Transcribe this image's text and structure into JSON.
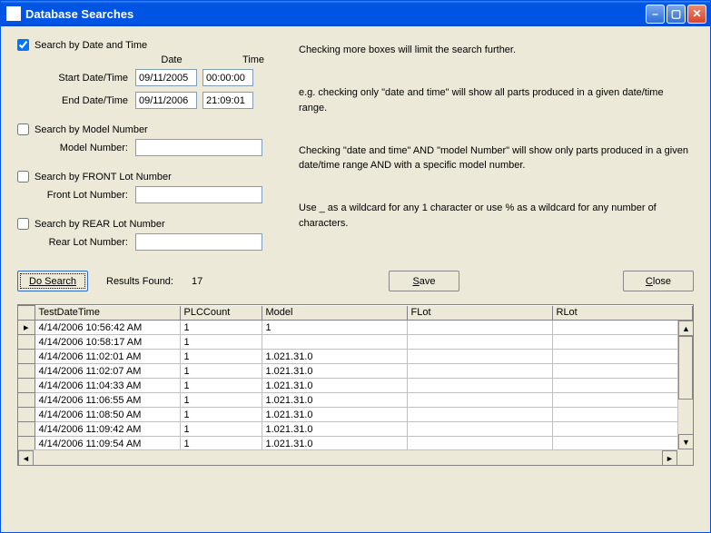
{
  "title": "Database Searches",
  "checks": {
    "dateTime": {
      "label": "Search by Date and Time",
      "checked": true
    },
    "model": {
      "label": "Search by Model Number",
      "checked": false
    },
    "frontLot": {
      "label": "Search by FRONT Lot Number",
      "checked": false
    },
    "rearLot": {
      "label": "Search by REAR Lot Number",
      "checked": false
    }
  },
  "headers": {
    "date": "Date",
    "time": "Time"
  },
  "fields": {
    "startLabel": "Start Date/Time",
    "startDate": "09/11/2005",
    "startTime": "00:00:00",
    "endLabel": "End Date/Time",
    "endDate": "09/11/2006",
    "endTime": "21:09:01",
    "modelLabel": "Model Number:",
    "modelValue": "",
    "frontLabel": "Front Lot Number:",
    "frontValue": "",
    "rearLabel": "Rear Lot Number:",
    "rearValue": ""
  },
  "buttons": {
    "doSearch": "Do Search",
    "save": "Save",
    "close": "Close"
  },
  "resultsLabel": "Results Found:",
  "resultsCount": "17",
  "help": {
    "p1": "Checking more boxes will limit the search further.",
    "p2": "e.g. checking only \"date and time\" will show all parts produced in a given date/time range.",
    "p3": "Checking \"date and time\" AND \"model Number\" will show only parts produced in a given date/time range AND with a specific model number.",
    "p4": "Use _ as a wildcard for any 1 character or use % as a wildcard for any number of characters."
  },
  "grid": {
    "columns": [
      "TestDateTime",
      "PLCCount",
      "Model",
      "FLot",
      "RLot"
    ],
    "rows": [
      {
        "TestDateTime": "4/14/2006 10:56:42 AM",
        "PLCCount": "1",
        "Model": "1",
        "FLot": "",
        "RLot": ""
      },
      {
        "TestDateTime": "4/14/2006 10:58:17 AM",
        "PLCCount": "1",
        "Model": "",
        "FLot": "",
        "RLot": ""
      },
      {
        "TestDateTime": "4/14/2006 11:02:01 AM",
        "PLCCount": "1",
        "Model": "1.021.31.0",
        "FLot": "",
        "RLot": ""
      },
      {
        "TestDateTime": "4/14/2006 11:02:07 AM",
        "PLCCount": "1",
        "Model": "1.021.31.0",
        "FLot": "",
        "RLot": ""
      },
      {
        "TestDateTime": "4/14/2006 11:04:33 AM",
        "PLCCount": "1",
        "Model": "1.021.31.0",
        "FLot": "",
        "RLot": ""
      },
      {
        "TestDateTime": "4/14/2006 11:06:55 AM",
        "PLCCount": "1",
        "Model": "1.021.31.0",
        "FLot": "",
        "RLot": ""
      },
      {
        "TestDateTime": "4/14/2006 11:08:50 AM",
        "PLCCount": "1",
        "Model": "1.021.31.0",
        "FLot": "",
        "RLot": ""
      },
      {
        "TestDateTime": "4/14/2006 11:09:42 AM",
        "PLCCount": "1",
        "Model": "1.021.31.0",
        "FLot": "",
        "RLot": ""
      },
      {
        "TestDateTime": "4/14/2006 11:09:54 AM",
        "PLCCount": "1",
        "Model": "1.021.31.0",
        "FLot": "",
        "RLot": ""
      }
    ]
  }
}
